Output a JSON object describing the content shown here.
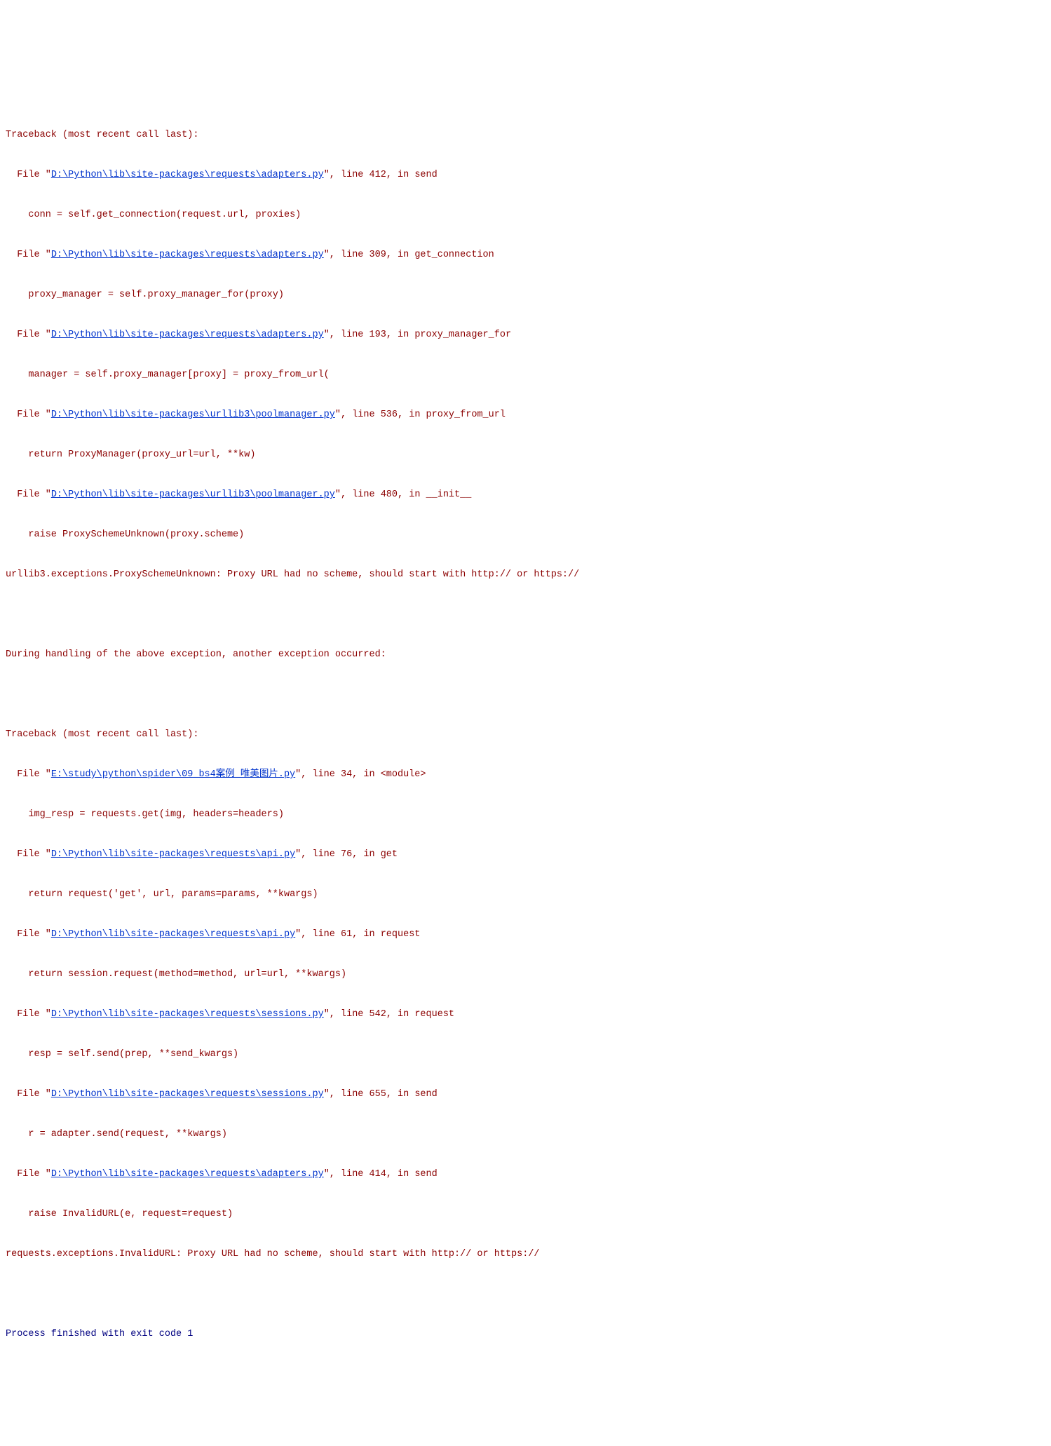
{
  "tb1": {
    "header": "Traceback (most recent call last):",
    "frames": [
      {
        "file": "D:\\Python\\lib\\site-packages\\requests\\adapters.py",
        "line": "412",
        "func": "send",
        "code": "    conn = self.get_connection(request.url, proxies)"
      },
      {
        "file": "D:\\Python\\lib\\site-packages\\requests\\adapters.py",
        "line": "309",
        "func": "get_connection",
        "code": "    proxy_manager = self.proxy_manager_for(proxy)"
      },
      {
        "file": "D:\\Python\\lib\\site-packages\\requests\\adapters.py",
        "line": "193",
        "func": "proxy_manager_for",
        "code": "    manager = self.proxy_manager[proxy] = proxy_from_url("
      },
      {
        "file": "D:\\Python\\lib\\site-packages\\urllib3\\poolmanager.py",
        "line": "536",
        "func": "proxy_from_url",
        "code": "    return ProxyManager(proxy_url=url, **kw)"
      },
      {
        "file": "D:\\Python\\lib\\site-packages\\urllib3\\poolmanager.py",
        "line": "480",
        "func": "__init__",
        "code": "    raise ProxySchemeUnknown(proxy.scheme)"
      }
    ],
    "exception": "urllib3.exceptions.ProxySchemeUnknown: Proxy URL had no scheme, should start with http:// or https://"
  },
  "chain": "During handling of the above exception, another exception occurred:",
  "tb2": {
    "header": "Traceback (most recent call last):",
    "frames": [
      {
        "file": "E:\\study\\python\\spider\\09_bs4案例_唯美图片.py",
        "line": "34",
        "func": "<module>",
        "code": "    img_resp = requests.get(img, headers=headers)"
      },
      {
        "file": "D:\\Python\\lib\\site-packages\\requests\\api.py",
        "line": "76",
        "func": "get",
        "code": "    return request('get', url, params=params, **kwargs)"
      },
      {
        "file": "D:\\Python\\lib\\site-packages\\requests\\api.py",
        "line": "61",
        "func": "request",
        "code": "    return session.request(method=method, url=url, **kwargs)"
      },
      {
        "file": "D:\\Python\\lib\\site-packages\\requests\\sessions.py",
        "line": "542",
        "func": "request",
        "code": "    resp = self.send(prep, **send_kwargs)"
      },
      {
        "file": "D:\\Python\\lib\\site-packages\\requests\\sessions.py",
        "line": "655",
        "func": "send",
        "code": "    r = adapter.send(request, **kwargs)"
      },
      {
        "file": "D:\\Python\\lib\\site-packages\\requests\\adapters.py",
        "line": "414",
        "func": "send",
        "code": "    raise InvalidURL(e, request=request)"
      }
    ],
    "exception": "requests.exceptions.InvalidURL: Proxy URL had no scheme, should start with http:// or https://"
  },
  "footer": "Process finished with exit code 1"
}
